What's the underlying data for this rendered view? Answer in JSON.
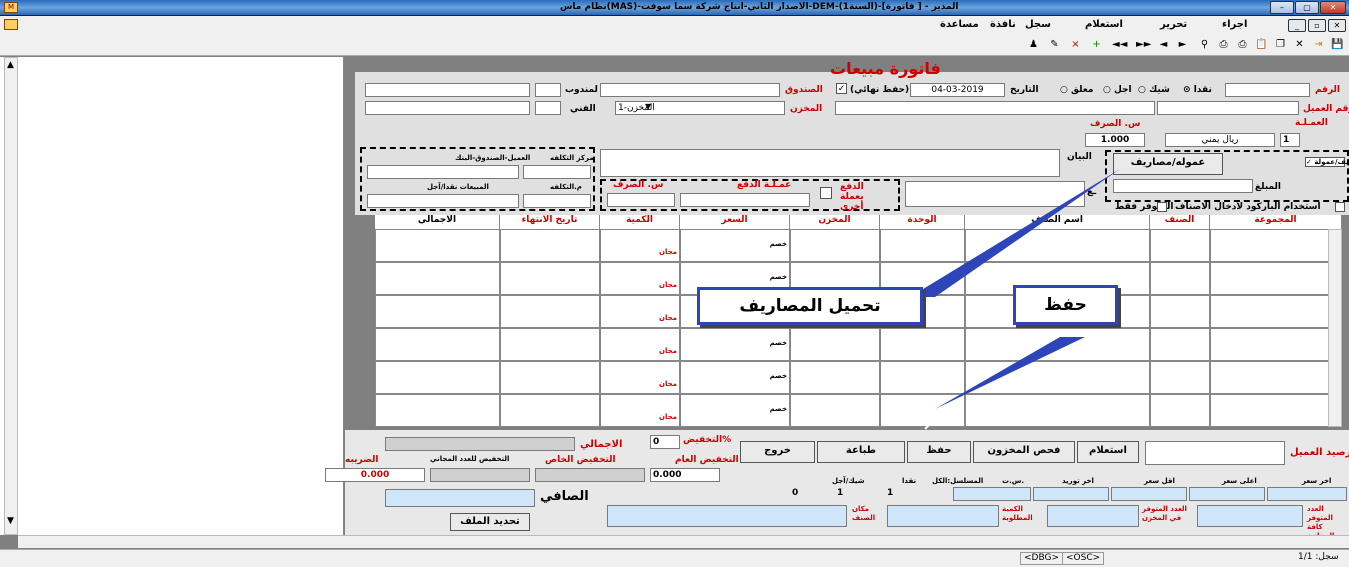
{
  "window": {
    "title": "نظام ماس(MAS)-الاصدار الثاني-انتاج شركة سما سوفت-DEM-(السنة1)-المدير - [ فاتورة]"
  },
  "menu": {
    "items": [
      "اجراء",
      "تحرير",
      "استعلام",
      "سجل",
      "نافذة",
      "مساعدة"
    ]
  },
  "toolbar": {
    "icons": [
      "save-icon",
      "exit-icon",
      "delete-icon",
      "copy-icon",
      "paste-icon",
      "print-icon",
      "print-preview-icon",
      "search-icon",
      "next-icon",
      "prev-icon",
      "last-icon",
      "first-icon",
      "add-icon",
      "remove-icon",
      "tools-icon",
      "user-icon"
    ]
  },
  "form": {
    "title": "فاتورة مبيعات",
    "labels": {
      "number": "الرقم",
      "customer_no": "رقم العميل",
      "currency": "العمـلـة",
      "exchange_rate": "س. الصرف",
      "date": "التاريخ",
      "cashbox": "الصندوق",
      "final_save": "(حفظ نهائي)",
      "warehouse": "المخزن",
      "delegate": "لمندوب",
      "technician": "الفني",
      "statement": "البيان",
      "amount": "المبلغ",
      "pay_other_currency": "الدفع بعملة أخرى",
      "payment_currency": "عمـلـة الدفع",
      "pay_exchange_rate": "س. الصرف",
      "cost_center": "مركز التكلفه",
      "cost_center_sub": "العميل-الصندوق-البنك",
      "cost_center2": "م.التكلفه",
      "sales_cash_credit": "المبيعات نقدا/آجل",
      "use_barcode": "استخدام الباركود لادخال الاصناف",
      "available_only": "المتوفر فقط",
      "expenses_commission": "مصاريف/عمولة",
      "receipt_partial": "ـع"
    },
    "payment_types": {
      "cash": "نقدا",
      "check": "شيك",
      "credit": "اجل",
      "suspended": "معلق"
    },
    "values": {
      "date": "04-03-2019",
      "currency_code": "1",
      "currency_name": "ريال يمني",
      "exchange_rate": "1.000",
      "warehouse": "1-المخزن"
    },
    "commission_button": "عموله/مصاريف"
  },
  "grid": {
    "headers": {
      "group": "المجموعة",
      "item": "الصنف",
      "item_name": "اسم الصنف",
      "unit": "الوحدة",
      "warehouse": "المخزن",
      "price": "السعر",
      "quantity": "الكمية",
      "expiry": "تاريخ الانتهاء",
      "total": "الاجمالي"
    },
    "row_labels": {
      "discount": "خصم",
      "free": "مجان"
    }
  },
  "bottom": {
    "labels": {
      "customer_balance": "رصيد العميل",
      "discount_pct": "التخفيض%",
      "total": "الاجمالي",
      "general_discount": "التخفيض العام",
      "special_discount": "التخفيض الخاص",
      "free_count_discount": "التخفيض للعدد المجاني",
      "tax": "الضريبه",
      "net": "الصافي",
      "update_file": "تحديد الملف"
    },
    "values": {
      "discount_pct": "0",
      "general_discount": "0.000",
      "tax": "0.000"
    },
    "buttons": {
      "inquiry": "استعلام",
      "check_warehouse": "فحص المخزون",
      "save": "حفظ",
      "print": "طباعة",
      "exit": "خروج"
    },
    "info_headers": {
      "last_price": "اخر سعر",
      "highest_price": "اعلى سعر",
      "lowest_price": "اقل سعر",
      "last_supply": "اخر توريد",
      "serial_no": "س.ت.",
      "serial_all": "المسلسل:الكل",
      "cash": "نقدا",
      "check_credit": "شيك/آجل"
    },
    "info_values": {
      "serial_all": "1",
      "cash": "1",
      "check_credit": "0"
    },
    "stock_labels": {
      "available_qty": "العدد المتوفر كافة المخازن",
      "available_store": "العدد المتوفر في المخزن",
      "quantity_required": "الكمية المطلوبة",
      "item_location": "مكان الصنف"
    }
  },
  "callouts": {
    "expenses": "تحميل المصاريف",
    "save": "حفظ"
  },
  "status": {
    "record": "سجل: 1/1",
    "dbg": "<DBG>",
    "osc": "<OSC>"
  }
}
